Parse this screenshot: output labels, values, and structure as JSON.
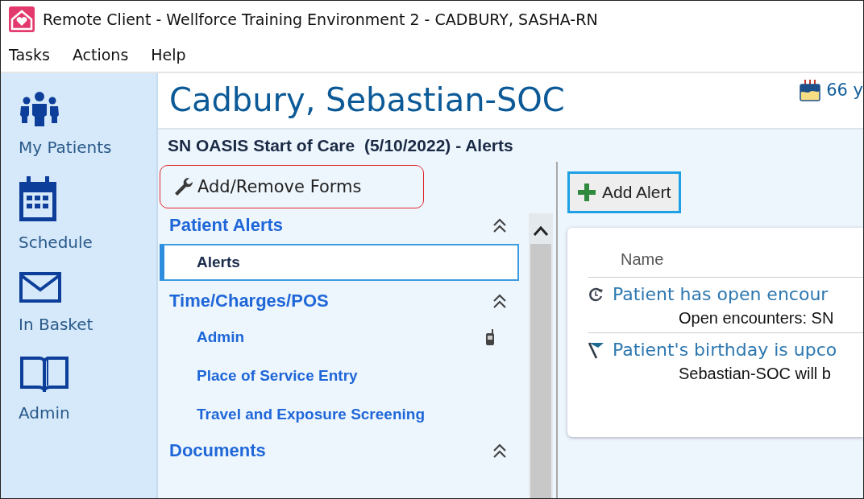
{
  "window": {
    "title": "Remote Client - Wellforce Training Environment 2 - CADBURY, SASHA-RN"
  },
  "menu": [
    "Tasks",
    "Actions",
    "Help"
  ],
  "nav": [
    {
      "label": "My Patients",
      "kind": "people"
    },
    {
      "label": "Schedule",
      "kind": "calendar"
    },
    {
      "label": "In Basket",
      "kind": "mail"
    },
    {
      "label": "Admin",
      "kind": "book"
    }
  ],
  "patient": {
    "name": "Cadbury, Sebastian-SOC",
    "age": "66 y"
  },
  "context": "SN OASIS Start of Care  (5/10/2022) - Alerts",
  "forms_button": {
    "label": "Add/Remove Forms",
    "highlighted": true
  },
  "sections": [
    {
      "title": "Patient Alerts",
      "expanded": true,
      "items": [
        {
          "label": "Alerts",
          "selected": true,
          "mobile": false
        }
      ]
    },
    {
      "title": "Time/Charges/POS",
      "expanded": true,
      "items": [
        {
          "label": "Admin",
          "selected": false,
          "mobile": true
        },
        {
          "label": "Place of Service Entry",
          "selected": false,
          "mobile": false
        },
        {
          "label": "Travel and Exposure Screening",
          "selected": false,
          "mobile": false
        }
      ]
    },
    {
      "title": "Documents",
      "expanded": true
    }
  ],
  "add_alert": {
    "label": "Add Alert"
  },
  "alerts": {
    "column": "Name",
    "rows": [
      {
        "kind": "encounter",
        "title": "Patient has open encour",
        "detail": "Open encounters: SN"
      },
      {
        "kind": "flag",
        "title": "Patient's birthday is upco",
        "detail": "Sebastian-SOC will b"
      }
    ]
  }
}
